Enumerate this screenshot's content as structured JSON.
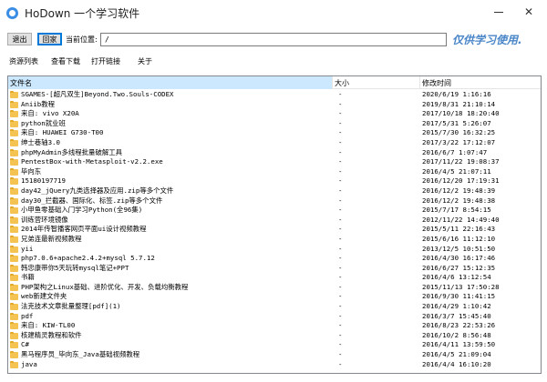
{
  "window": {
    "title": "HoDown  一个学习软件",
    "minimize_glyph": "",
    "close_glyph": "✕"
  },
  "toolbar": {
    "back_label": "退出",
    "home_label": "回家",
    "location_label": "当前位置:",
    "location_value": "/",
    "watermark": "仅供学习使用."
  },
  "menu": {
    "items": [
      "资源列表",
      "查看下载",
      "打开链接",
      "关于"
    ]
  },
  "table": {
    "headers": {
      "name": "文件名",
      "size": "大小",
      "time": "修改时间"
    },
    "rows": [
      {
        "name": "SGAMES-[超凡双生]Beyond.Two.Souls-CODEX",
        "size": "-",
        "time": "2020/6/19 1:16:16"
      },
      {
        "name": "Aniib教程",
        "size": "-",
        "time": "2019/8/31 21:10:14"
      },
      {
        "name": "来自: vivo X20A",
        "size": "-",
        "time": "2017/10/18 18:20:40"
      },
      {
        "name": "python就业班",
        "size": "-",
        "time": "2017/5/31 5:26:07"
      },
      {
        "name": "来自: HUAWEI G730-T00",
        "size": "-",
        "time": "2015/7/30 16:32:25"
      },
      {
        "name": "绅士巷轴3.0",
        "size": "-",
        "time": "2017/3/22 17:12:07"
      },
      {
        "name": "phpMyAdmin多线程批量破解工具",
        "size": "-",
        "time": "2016/6/7 1:07:47"
      },
      {
        "name": "PentestBox-with-Metasploit-v2.2.exe",
        "size": "-",
        "time": "2017/11/22 19:08:37"
      },
      {
        "name": "毕向东",
        "size": "-",
        "time": "2016/4/5 21:07:11"
      },
      {
        "name": "15180197719",
        "size": "-",
        "time": "2016/12/20 17:19:31"
      },
      {
        "name": "day42_jQuery九类选择器及应用.zip等多个文件",
        "size": "-",
        "time": "2016/12/2 19:48:39"
      },
      {
        "name": "day30_拦截器、国际化、标签.zip等多个文件",
        "size": "-",
        "time": "2016/12/2 19:48:38"
      },
      {
        "name": "小甲鱼零基础入门学习Python(全96集)",
        "size": "-",
        "time": "2015/7/17 8:54:15"
      },
      {
        "name": "训练营环境镜像",
        "size": "-",
        "time": "2012/11/22 14:49:40"
      },
      {
        "name": "2014年传智播客网页平面ui设计视频教程",
        "size": "-",
        "time": "2015/5/11 22:16:43"
      },
      {
        "name": "兄弟连最新视频教程",
        "size": "-",
        "time": "2015/6/16 11:12:10"
      },
      {
        "name": "yii",
        "size": "-",
        "time": "2013/12/5 10:51:50"
      },
      {
        "name": "php7.0.6+apache2.4.2+mysql 5.7.12",
        "size": "-",
        "time": "2016/4/30 16:17:46"
      },
      {
        "name": "韩忠康带你5天玩转mysql笔记+PPT",
        "size": "-",
        "time": "2016/6/27 15:12:35"
      },
      {
        "name": "书籍",
        "size": "-",
        "time": "2016/4/6 13:12:54"
      },
      {
        "name": "PHP架构之Linux基础、进阶优化、开发、负载均衡教程",
        "size": "-",
        "time": "2015/11/13 17:50:28"
      },
      {
        "name": "web新建文件夹",
        "size": "-",
        "time": "2016/9/30 11:41:15"
      },
      {
        "name": "法克技术文章批量整理[pdf](1)",
        "size": "-",
        "time": "2016/4/29 1:10:42"
      },
      {
        "name": "pdf",
        "size": "-",
        "time": "2016/3/7 15:45:40"
      },
      {
        "name": "来自: KIW-TL00",
        "size": "-",
        "time": "2016/8/23 22:53:26"
      },
      {
        "name": "核建精灵教程和软件",
        "size": "-",
        "time": "2016/10/2 8:56:48"
      },
      {
        "name": "C#",
        "size": "-",
        "time": "2016/4/11 13:59:50"
      },
      {
        "name": "黑马程序员_毕向东_Java基础视频教程",
        "size": "-",
        "time": "2016/4/5 21:09:04"
      },
      {
        "name": "java",
        "size": "-",
        "time": "2016/4/4 16:10:20"
      }
    ]
  }
}
